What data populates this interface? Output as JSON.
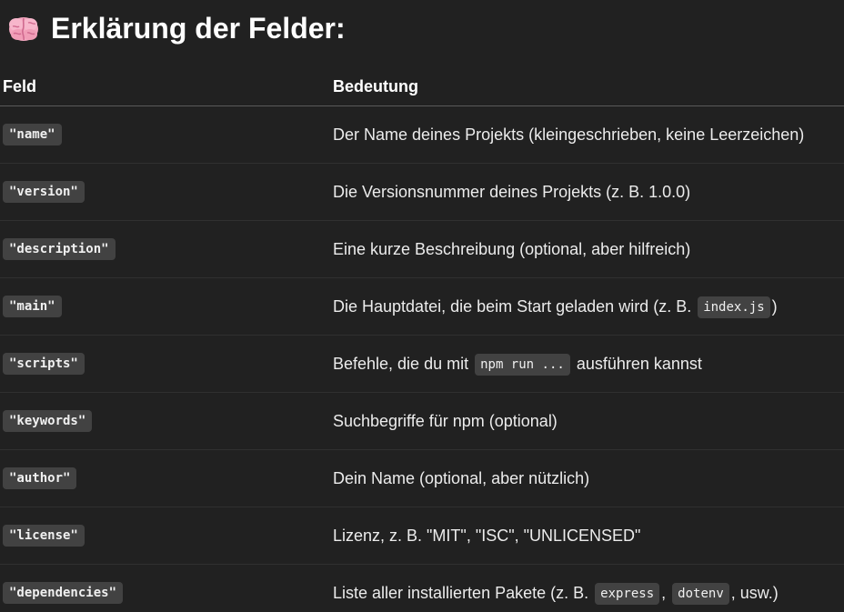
{
  "heading": {
    "icon": "brain-icon",
    "title": "Erklärung der Felder:"
  },
  "table": {
    "headers": [
      "Feld",
      "Bedeutung"
    ],
    "rows": [
      {
        "field": "\"name\"",
        "desc_parts": [
          {
            "text": "Der Name deines Projekts (kleingeschrieben, keine Leerzeichen)"
          }
        ]
      },
      {
        "field": "\"version\"",
        "desc_parts": [
          {
            "text": "Die Versionsnummer deines Projekts (z. B. 1.0.0)"
          }
        ]
      },
      {
        "field": "\"description\"",
        "desc_parts": [
          {
            "text": "Eine kurze Beschreibung (optional, aber hilfreich)"
          }
        ]
      },
      {
        "field": "\"main\"",
        "desc_parts": [
          {
            "text": "Die Hauptdatei, die beim Start geladen wird (z. B. "
          },
          {
            "code": "index.js"
          },
          {
            "text": ")"
          }
        ]
      },
      {
        "field": "\"scripts\"",
        "desc_parts": [
          {
            "text": "Befehle, die du mit "
          },
          {
            "code": "npm run ..."
          },
          {
            "text": " ausführen kannst"
          }
        ]
      },
      {
        "field": "\"keywords\"",
        "desc_parts": [
          {
            "text": "Suchbegriffe für npm (optional)"
          }
        ]
      },
      {
        "field": "\"author\"",
        "desc_parts": [
          {
            "text": "Dein Name (optional, aber nützlich)"
          }
        ]
      },
      {
        "field": "\"license\"",
        "desc_parts": [
          {
            "text": "Lizenz, z. B. \"MIT\", \"ISC\", \"UNLICENSED\""
          }
        ]
      },
      {
        "field": "\"dependencies\"",
        "desc_parts": [
          {
            "text": "Liste aller installierten Pakete (z. B. "
          },
          {
            "code": "express"
          },
          {
            "text": ", "
          },
          {
            "code": "dotenv"
          },
          {
            "text": ", usw.)"
          }
        ]
      }
    ]
  },
  "colors": {
    "background": "#212121",
    "code_background": "#424242",
    "text": "#ececec",
    "brain_pink": "#f4a8c0"
  }
}
